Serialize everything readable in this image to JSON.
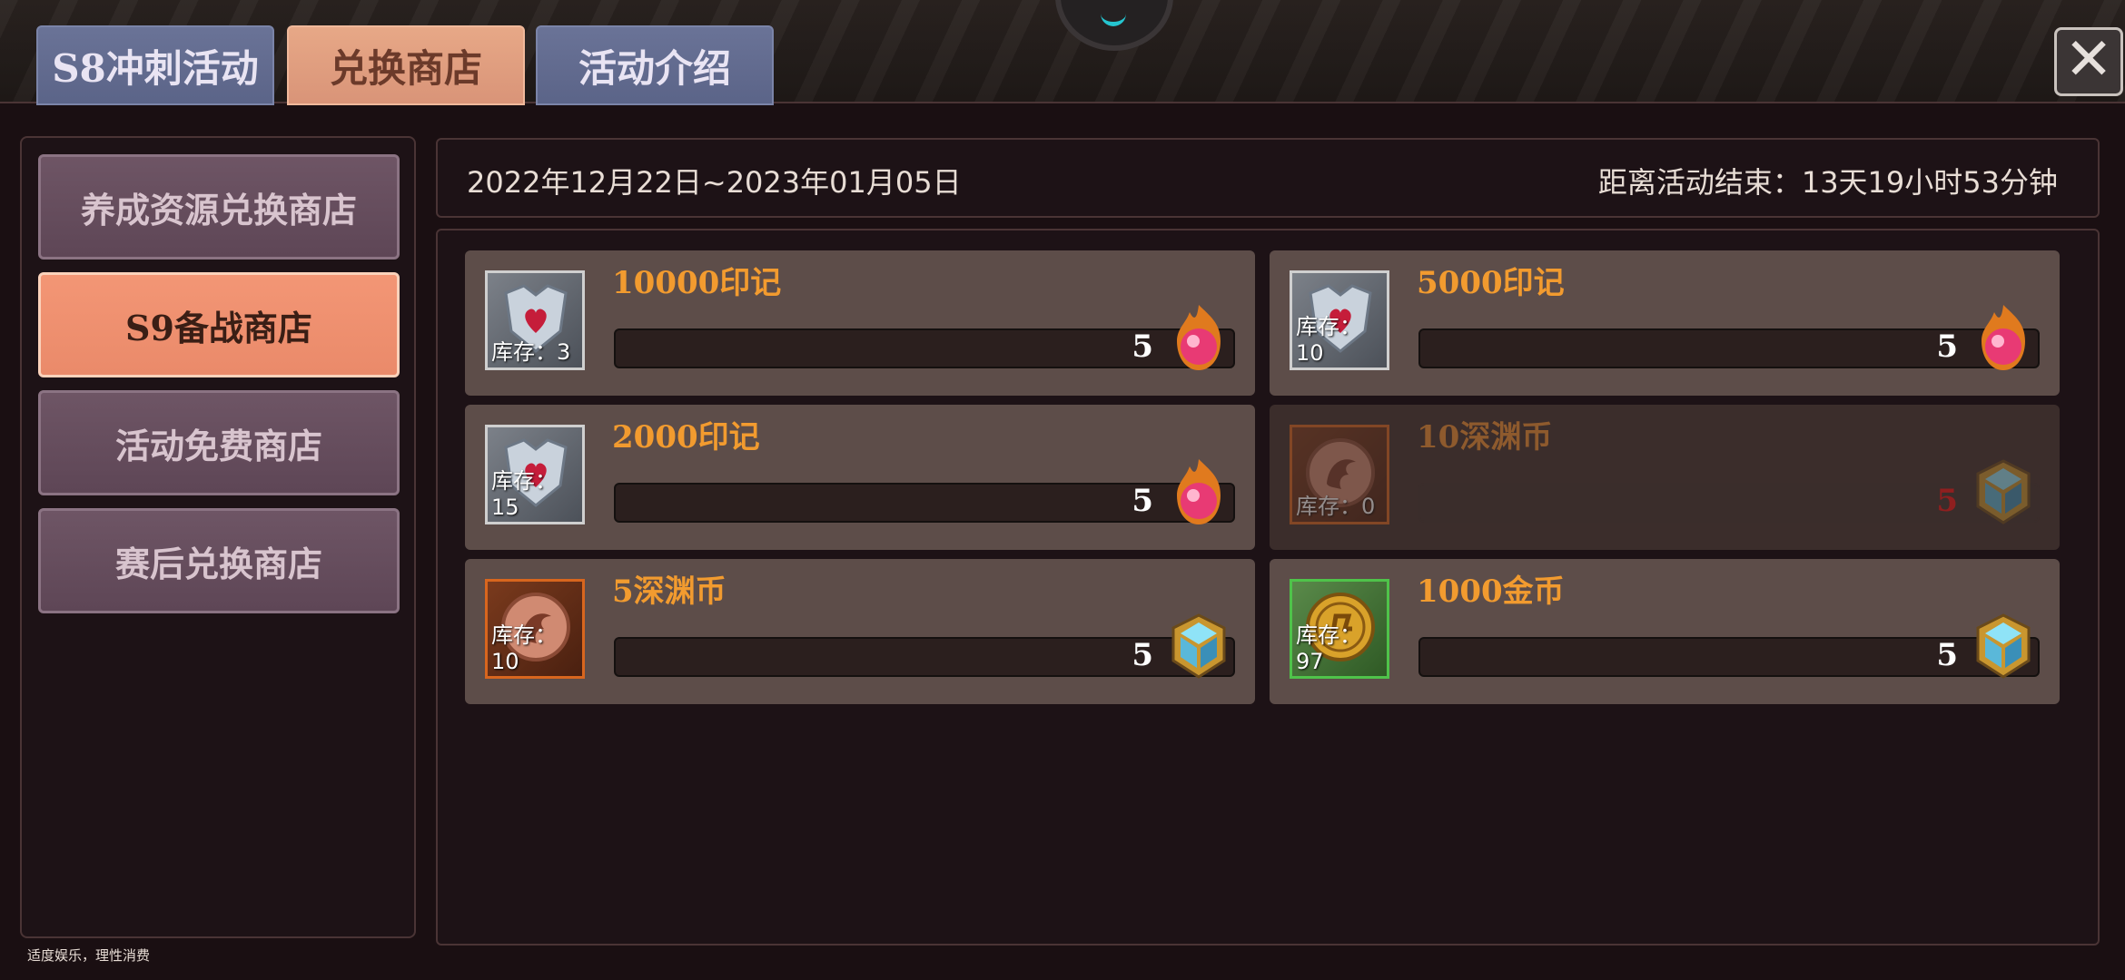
{
  "tabs": [
    {
      "label": "S8冲刺活动"
    },
    {
      "label": "兑换商店"
    },
    {
      "label": "活动介绍"
    }
  ],
  "active_tab": "兑换商店",
  "sidebar": {
    "items": [
      {
        "label": "养成资源兑换商店"
      },
      {
        "label": "S9备战商店"
      },
      {
        "label": "活动免费商店"
      },
      {
        "label": "赛后兑换商店"
      }
    ],
    "active": "S9备战商店"
  },
  "info": {
    "date_range": "2022年12月22日~2023年01月05日",
    "countdown": "距离活动结束：13天19小时53分钟"
  },
  "items": [
    {
      "title": "10000印记",
      "stock": "库存：3",
      "price": "5",
      "item_icon": "shield-heart-icon",
      "currency_icon": "fire-orb-icon",
      "available": true
    },
    {
      "title": "5000印记",
      "stock": "库存：10",
      "price": "5",
      "item_icon": "shield-heart-icon",
      "currency_icon": "fire-orb-icon",
      "available": true
    },
    {
      "title": "2000印记",
      "stock": "库存：15",
      "price": "5",
      "item_icon": "shield-heart-icon",
      "currency_icon": "fire-orb-icon",
      "available": true
    },
    {
      "title": "10深渊币",
      "stock": "库存：0",
      "price": "5",
      "item_icon": "dragon-coin-icon",
      "currency_icon": "crystal-cube-icon",
      "available": false
    },
    {
      "title": "5深渊币",
      "stock": "库存：10",
      "price": "5",
      "item_icon": "dragon-coin-icon",
      "currency_icon": "crystal-cube-icon",
      "available": true
    },
    {
      "title": "1000金币",
      "stock": "库存：97",
      "price": "5",
      "item_icon": "gold-coin-icon",
      "currency_icon": "crystal-cube-icon",
      "available": true
    }
  ],
  "footer_note": "适度娱乐，理性消费",
  "colors": {
    "active_tab": "#e7a887",
    "inactive_tab": "#6a7397",
    "active_side": "#f39675",
    "side_item": "#6e5565",
    "item_title": "#f29b2f",
    "card_bg": "#5d4d49"
  }
}
